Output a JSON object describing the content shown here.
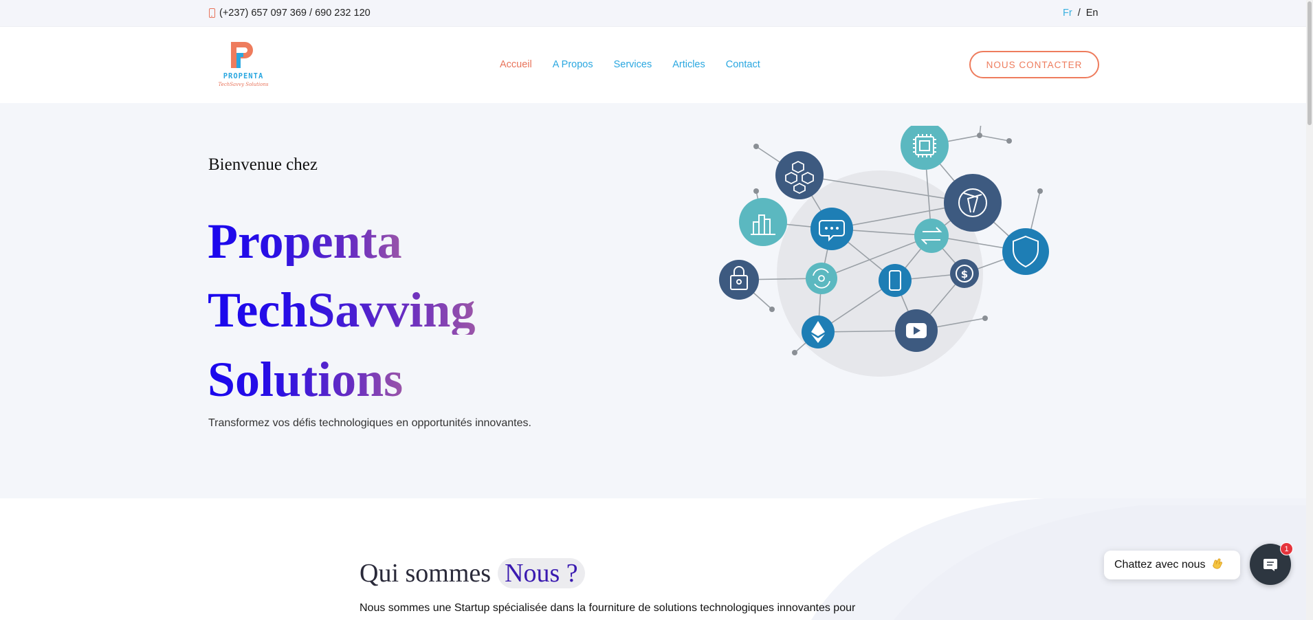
{
  "topbar": {
    "phone": "(+237) 657 097 369 / 690 232 120",
    "lang_fr": "Fr",
    "lang_sep": "/",
    "lang_en": "En"
  },
  "header": {
    "logo_word": "PROPENTA",
    "logo_sub": "TechSavvy Solutions",
    "nav": [
      "Accueil",
      "A Propos",
      "Services",
      "Articles",
      "Contact"
    ],
    "active_nav": "Accueil",
    "cta": "NOUS CONTACTER"
  },
  "hero": {
    "welcome": "Bienvenue chez",
    "title_line1": "Propenta",
    "title_line2": "TechSavving",
    "title_line3": "Solutions",
    "subtitle": "Transformez vos défis technologiques en opportunités innovantes."
  },
  "about": {
    "title": "Qui sommes",
    "title_accent": "Nous ?",
    "text": "Nous sommes une Startup spécialisée dans la fourniture de solutions technologiques innovantes pour répondre aux besoins de nos clients."
  },
  "chat": {
    "label": "Chattez avec nous",
    "badge": "1"
  },
  "colors": {
    "accent_orange": "#ee7c5d",
    "accent_blue": "#2aa7e0",
    "title_gradient_start": "#1a06ee",
    "title_gradient_end": "#9a55a8"
  }
}
